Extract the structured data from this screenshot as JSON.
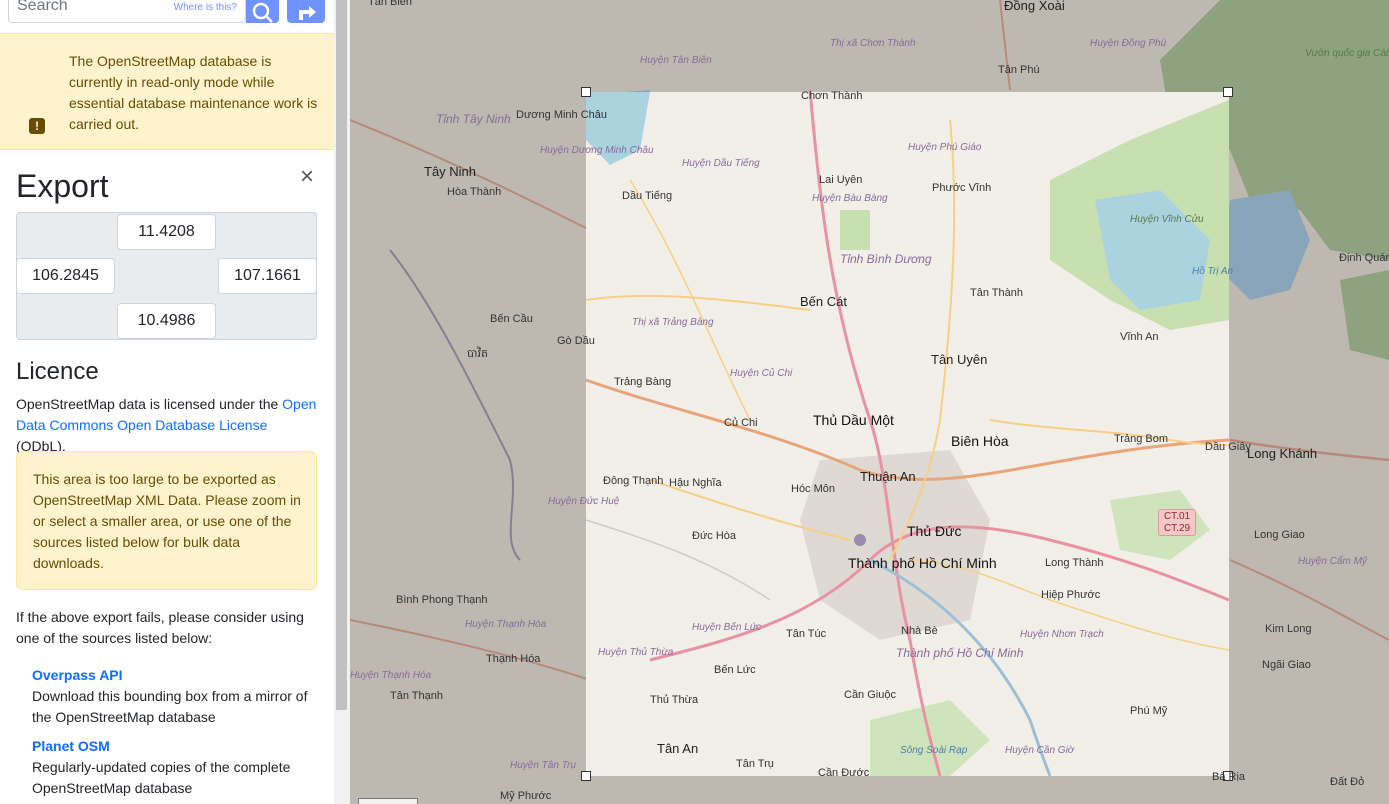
{
  "search": {
    "placeholder": "Search",
    "where_link": "Where is this?"
  },
  "notice": {
    "text": "The OpenStreetMap database is currently in read-only mode while essential database maintenance work is carried out."
  },
  "export": {
    "title": "Export",
    "close_symbol": "×",
    "north": "11.4208",
    "west": "106.2845",
    "east": "107.1661",
    "south": "10.4986"
  },
  "licence": {
    "title": "Licence",
    "text_before": "OpenStreetMap data is licensed under the ",
    "link_text": "Open Data Commons Open Database License",
    "text_after": " (ODbL)."
  },
  "warning": {
    "text": "This area is too large to be exported as OpenStreetMap XML Data. Please zoom in or select a smaller area, or use one of the sources listed below for bulk data downloads."
  },
  "fallback": {
    "text": "If the above export fails, please consider using one of the sources listed below:",
    "sources": [
      {
        "title": "Overpass API",
        "desc": "Download this bounding box from a mirror of the OpenStreetMap database"
      },
      {
        "title": "Planet OSM",
        "desc": "Regularly-updated copies of the complete OpenStreetMap database"
      }
    ]
  },
  "map": {
    "places": [
      "Tân Biên",
      "Đồng Xoài",
      "Thị xã Chơn Thành",
      "Huyện Đồng Phú",
      "Tân Phú",
      "Vườn quốc gia Cát Tiên",
      "Huyện Tân Biên",
      "Dương Minh Châu",
      "Chơn Thành",
      "Tỉnh Tây Ninh",
      "Huyện Dương Minh Châu",
      "Tây Ninh",
      "Hòa Thành",
      "Huyện Dầu Tiếng",
      "Huyện Phú Giáo",
      "Lai Uyên",
      "Phước Vĩnh",
      "Dầu Tiếng",
      "Huyện Bàu Bàng",
      "Huyện Vĩnh Cửu",
      "Hồ Trị An",
      "Tỉnh Bình Dương",
      "Định Quán",
      "Tân Thành",
      "Bến Cát",
      "Bến Cầu",
      "Gò Dầu",
      "បាវិត",
      "Thị xã Trảng Bàng",
      "Tân Uyên",
      "Vĩnh An",
      "Trảng Bàng",
      "Huyện Củ Chi",
      "Thủ Dầu Một",
      "Củ Chi",
      "Biên Hòa",
      "Trảng Bom",
      "Dầu Giây",
      "Long Khánh",
      "Thuận An",
      "Đông Thạnh",
      "Hậu Nghĩa",
      "Hóc Môn",
      "Huyện Đức Huệ",
      "Thủ Đức",
      "Đức Hòa",
      "Long Giao",
      "Thành phố Hồ Chí Minh",
      "Long Thành",
      "Huyện Cẩm Mỹ",
      "Bình Phong Thạnh",
      "Hiệp Phước",
      "Huyện Thạnh Hóa",
      "Huyện Bến Lức",
      "Tân Túc",
      "Nhà Bè",
      "Huyện Nhơn Trạch",
      "Kim Long",
      "Thạnh Hóa",
      "Huyện Thủ Thừa",
      "Thành phố Hồ Chí Minh",
      "Ngãi Giao",
      "Bến Lức",
      "Tân Thạnh",
      "Thủ Thừa",
      "Cần Giuộc",
      "Phú Mỹ",
      "Tân An",
      "Sông Soài Rạp",
      "Huyện Cần Giờ",
      "Tân Trụ",
      "Cần Đước",
      "Bà Rịa",
      "Đất Đỏ",
      "Mỹ Phước",
      "Huyện Tân Trụ",
      "Huyện Thạnh Hóa"
    ],
    "shield": {
      "line1": "CT.01",
      "line2": "CT.29"
    }
  }
}
